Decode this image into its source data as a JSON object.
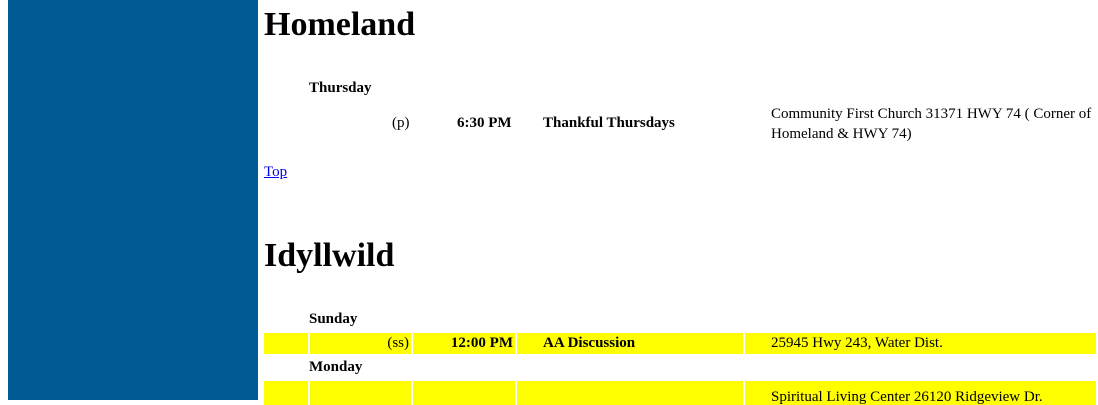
{
  "sections": [
    {
      "title": "Homeland",
      "days": [
        {
          "day": "Thursday",
          "meetings": [
            {
              "type": "(p)",
              "time": "6:30 PM",
              "name": "Thankful Thursdays",
              "location": "Community First Church 31371 HWY 74 ( Corner of Homeland & HWY 74)"
            }
          ]
        }
      ],
      "top_link": "Top"
    },
    {
      "title": "Idyllwild",
      "days": [
        {
          "day": "Sunday",
          "meetings": [
            {
              "type": "(ss)",
              "time": "12:00 PM",
              "name": "AA Discussion",
              "location": "25945 Hwy 243, Water Dist.",
              "highlight": "#ffff00"
            }
          ]
        },
        {
          "day": "Monday",
          "meetings": [
            {
              "type": "",
              "time": "",
              "name": "",
              "location": "Spiritual Living Center 26120 Ridgeview Dr.",
              "highlight": "#ffff00"
            }
          ]
        }
      ]
    }
  ]
}
